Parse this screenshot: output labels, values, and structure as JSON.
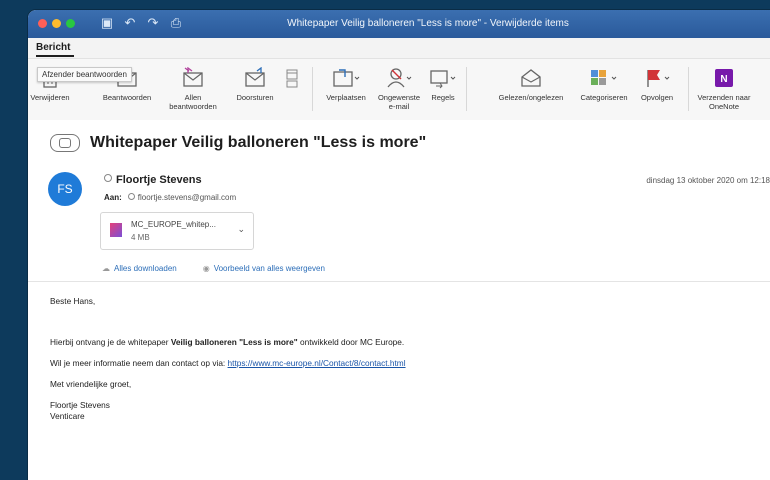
{
  "window": {
    "title": "Whitepaper Veilig balloneren \"Less is more\" - Verwijderde items"
  },
  "ribbon": {
    "tab": "Bericht",
    "tooltip": "Afzender beantwoorden",
    "help": "?",
    "buttons": {
      "delete": "Verwijderen",
      "reply": "Beantwoorden",
      "reply_all": "Allen beantwoorden",
      "forward": "Doorsturen",
      "move": "Verplaatsen",
      "junk": "Ongewenste e-mail",
      "rules": "Regels",
      "read_unread": "Gelezen/ongelezen",
      "categorize": "Categoriseren",
      "follow_up": "Opvolgen",
      "onenote": "Verzenden naar OneNote"
    }
  },
  "message": {
    "subject": "Whitepaper Veilig balloneren \"Less is more\"",
    "avatar_initials": "FS",
    "sender": "Floortje Stevens",
    "date": "dinsdag 13 oktober 2020 om 12:18",
    "to_label": "Aan:",
    "to_address": "floortje.stevens@gmail.com",
    "attachment": {
      "name": "MC_EUROPE_whitep...",
      "size": "4 MB"
    },
    "download_all": "Alles downloaden",
    "preview_all": "Voorbeeld van alles weergeven",
    "body": {
      "greeting": "Beste Hans,",
      "line1_pre": "Hierbij ontvang je de whitepaper ",
      "line1_bold": "Veilig balloneren \"Less is more\"",
      "line1_post": " ontwikkeld door MC Europe.",
      "line2_pre": "Wil je meer informatie neem dan contact op via: ",
      "link": "https://www.mc-europe.nl/Contact/8/contact.html",
      "closing": "Met vriendelijke groet,",
      "sig_name": "Floortje Stevens",
      "sig_company": "Venticare"
    }
  },
  "colors": {
    "titlebar": "#2f63a6",
    "avatar": "#1f7bd8",
    "link": "#1a55a8",
    "background": "#0d3a5c"
  }
}
